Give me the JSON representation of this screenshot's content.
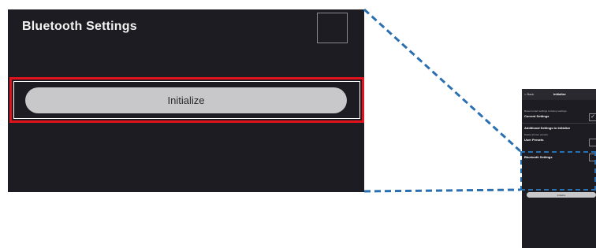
{
  "zoom": {
    "title": "Bluetooth Settings",
    "button_label": "Initialize"
  },
  "phone": {
    "back_label": "< Back",
    "title": "Initialize",
    "desc1": "Reset current settings to factory settings.",
    "current_settings_label": "Current Settings",
    "additional_label": "Additional Settings to Initialize",
    "desc2": "Delete all user presets.",
    "user_presets_label": "User Presets",
    "bluetooth_label": "Bluetooth Settings",
    "button_label": "Initialize"
  },
  "colors": {
    "panel_bg": "#1d1c22",
    "highlight_red": "#e0121b",
    "dash_blue": "#2a6fb0",
    "button_gray": "#c8c8ca"
  }
}
